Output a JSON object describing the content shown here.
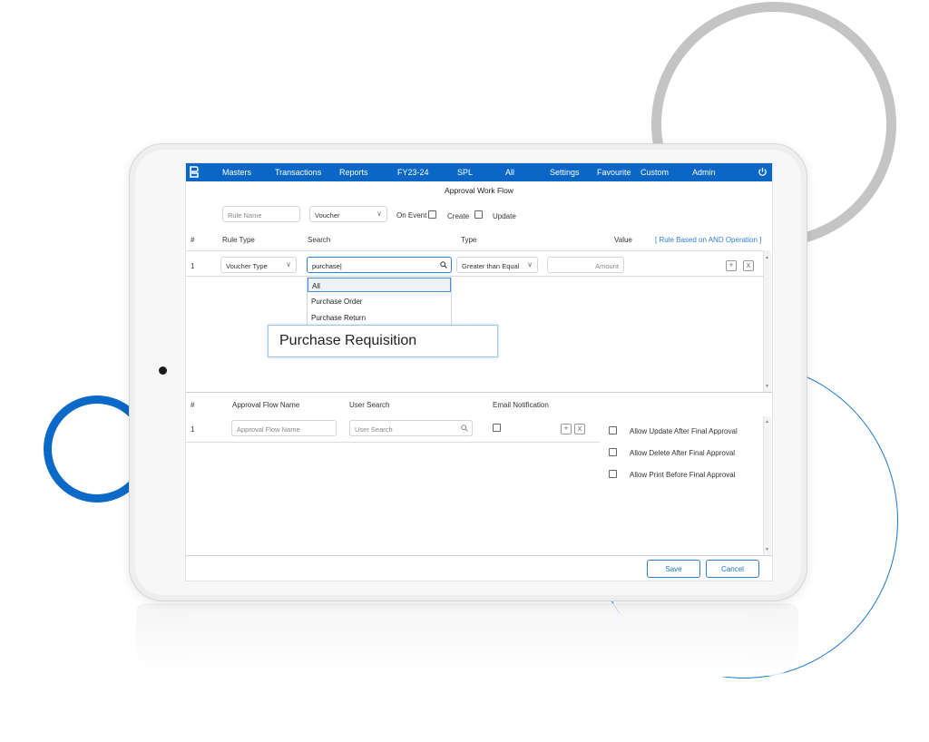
{
  "nav": {
    "items": [
      "Masters",
      "Transactions",
      "Reports",
      "FY23-24",
      "SPL",
      "All",
      "Settings",
      "Favourite",
      "Custom",
      "Admin"
    ]
  },
  "page": {
    "title": "Approval Work Flow"
  },
  "rule": {
    "name_placeholder": "Rule Name",
    "voucher_select": "Voucher",
    "on_event_label": "On Event :",
    "create_label": "Create",
    "update_label": "Update"
  },
  "rule_table": {
    "headers": {
      "num": "#",
      "rule_type": "Rule Type",
      "search": "Search",
      "type": "Type",
      "value": "Value",
      "note": "[ Rule Based on AND Operation ]"
    },
    "row": {
      "num": "1",
      "rule_type": "Voucher Type",
      "search_value": "purchase",
      "type": "Greater than Equal",
      "amount_placeholder": "Amount"
    }
  },
  "dropdown": {
    "options": [
      "All",
      "Purchase Order",
      "Purchase Return"
    ],
    "selected_index": 0
  },
  "highlight": {
    "text": "Purchase Requisition"
  },
  "flow_table": {
    "headers": {
      "num": "#",
      "name": "Approval Flow Name",
      "user_search": "User Search",
      "email": "Email Notification"
    },
    "row": {
      "num": "1",
      "name_placeholder": "Approval Flow Name",
      "user_placeholder": "User Search"
    },
    "options": [
      "Allow Update After Final Approval",
      "Allow Delete After Final Approval",
      "Allow Print Before Final Approval"
    ]
  },
  "actions": {
    "save": "Save",
    "cancel": "Cancel"
  },
  "colors": {
    "brand": "#0a67c6",
    "ring_gray": "#c4c4c4",
    "ring_blue": "#0b69c7"
  }
}
